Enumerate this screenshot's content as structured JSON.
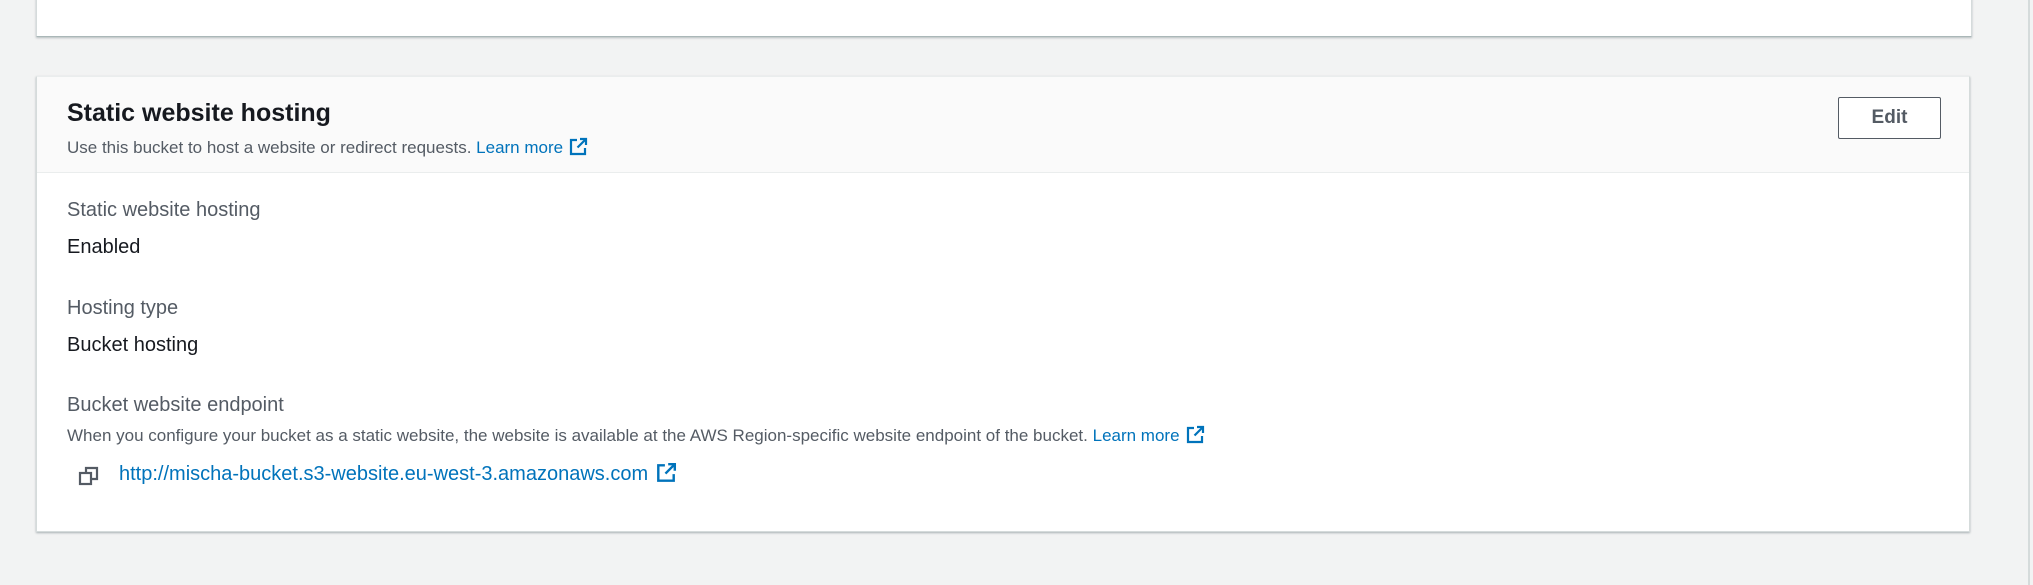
{
  "panel": {
    "title": "Static website hosting",
    "description": "Use this bucket to host a website or redirect requests.",
    "learn_more": "Learn more",
    "edit_label": "Edit"
  },
  "fields": {
    "hosting": {
      "label": "Static website hosting",
      "value": "Enabled"
    },
    "hosting_type": {
      "label": "Hosting type",
      "value": "Bucket hosting"
    },
    "endpoint": {
      "label": "Bucket website endpoint",
      "description": "When you configure your bucket as a static website, the website is available at the AWS Region-specific website endpoint of the bucket.",
      "learn_more": "Learn more",
      "url": "http://mischa-bucket.s3-website.eu-west-3.amazonaws.com"
    }
  },
  "icons": {
    "external_link": "external-link-icon",
    "copy": "copy-icon"
  },
  "colors": {
    "link": "#0073bb",
    "text": "#16191f",
    "secondary_text": "#545b64",
    "background": "#f2f3f3"
  }
}
